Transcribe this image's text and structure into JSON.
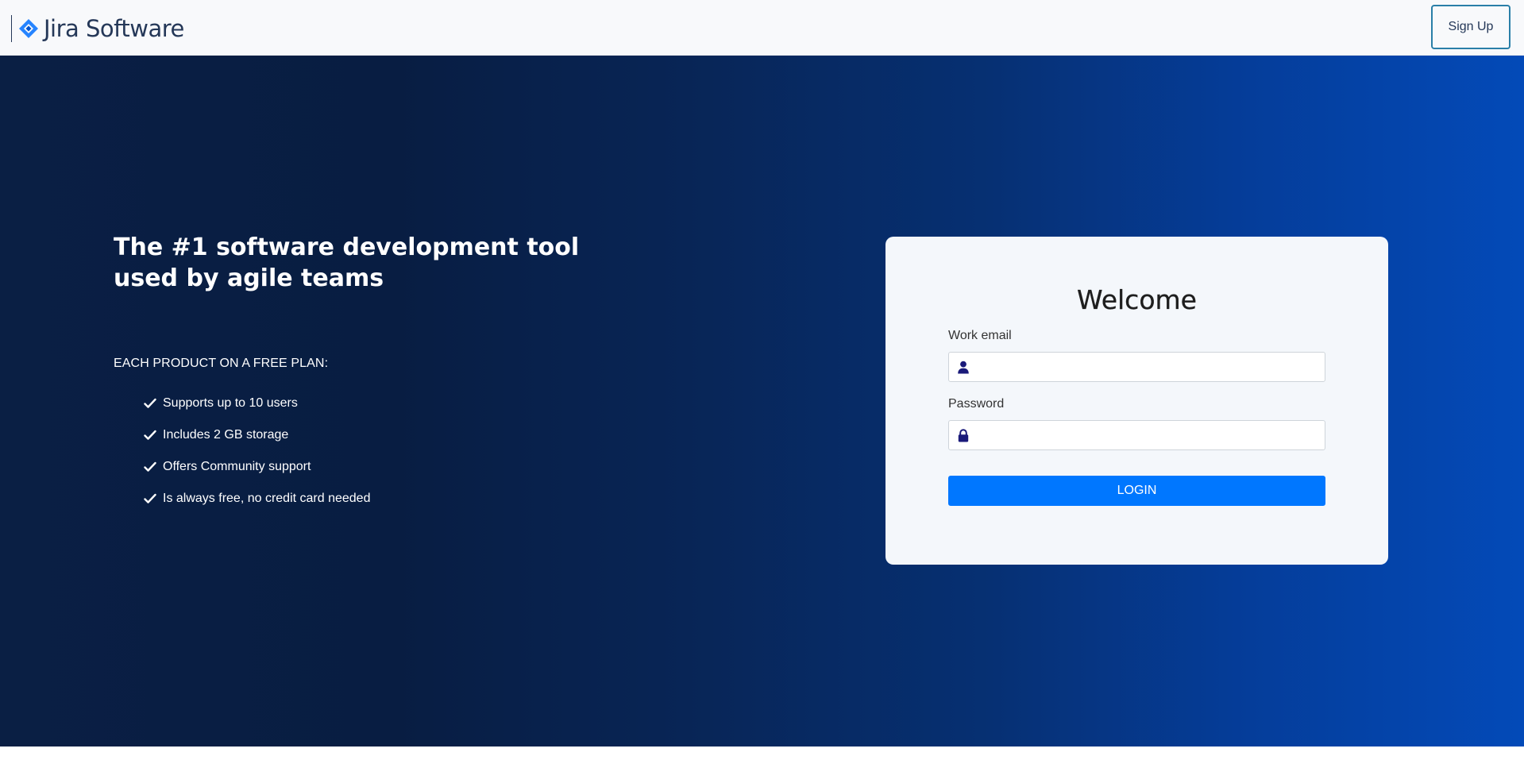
{
  "header": {
    "brand": "Jira Software",
    "signup_label": "Sign Up",
    "logo_icon": "jira-diamond-icon",
    "logo_color": "#2684ff"
  },
  "hero": {
    "headline": "The #1 software development tool used by agile teams",
    "subheadline": "EACH PRODUCT ON A FREE PLAN:",
    "features": [
      {
        "label": "Supports up to 10 users",
        "icon": "check-icon"
      },
      {
        "label": "Includes 2 GB storage",
        "icon": "check-icon"
      },
      {
        "label": "Offers Community support",
        "icon": "check-icon"
      },
      {
        "label": "Is always free, no credit card needed",
        "icon": "check-icon"
      }
    ],
    "gradient_start": "#0a1f44",
    "gradient_end": "#034ab8"
  },
  "login": {
    "title": "Welcome",
    "email_label": "Work email",
    "email_value": "",
    "email_icon": "user-icon",
    "password_label": "Password",
    "password_value": "",
    "password_icon": "lock-icon",
    "submit_label": "LOGIN",
    "accent": "#0077ff",
    "icon_color": "#1a1a7a"
  }
}
